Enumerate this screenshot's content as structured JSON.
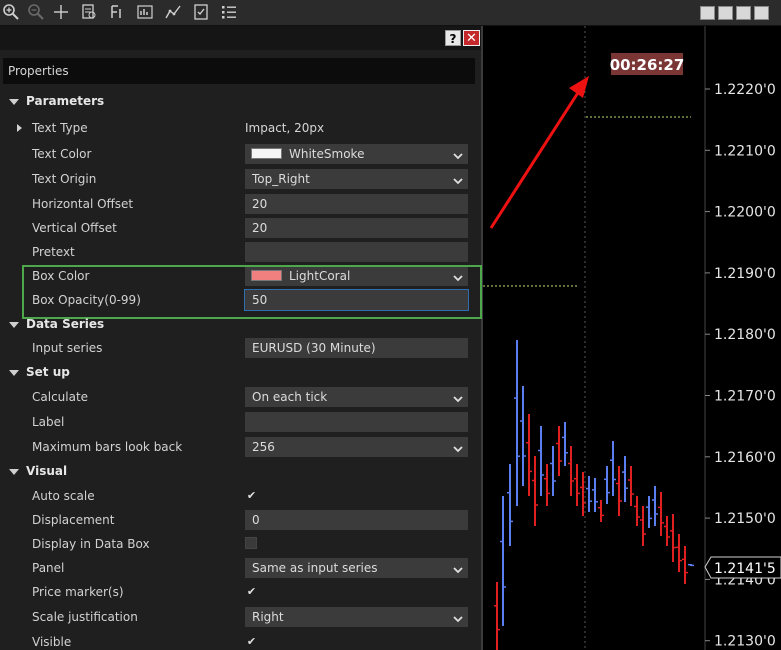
{
  "toolbar": {
    "icons": [
      "zoom-in-icon",
      "zoom-out-icon",
      "crosshair-icon",
      "data-box-icon",
      "bar-style-icon",
      "chart-style-icon",
      "drawing-tools-icon",
      "properties-icon",
      "list-icon"
    ]
  },
  "dialog": {
    "help_label": "?",
    "close_label": "✕",
    "header": "Properties"
  },
  "sections": {
    "parameters": "Parameters",
    "data_series": "Data Series",
    "setup": "Set up",
    "visual": "Visual"
  },
  "props": {
    "text_type": {
      "label": "Text Type",
      "value": "Impact, 20px"
    },
    "text_color": {
      "label": "Text Color",
      "value": "WhiteSmoke",
      "swatch": "#f5f5f5"
    },
    "text_origin": {
      "label": "Text Origin",
      "value": "Top_Right"
    },
    "horizontal_offset": {
      "label": "Horizontal Offset",
      "value": "20"
    },
    "vertical_offset": {
      "label": "Vertical Offset",
      "value": "20"
    },
    "pretext": {
      "label": "Pretext",
      "value": ""
    },
    "box_color": {
      "label": "Box Color",
      "value": "LightCoral",
      "swatch": "#f08080"
    },
    "box_opacity": {
      "label": "Box Opacity(0-99)",
      "value": "50"
    },
    "input_series": {
      "label": "Input series",
      "value": "EURUSD (30 Minute)"
    },
    "calculate": {
      "label": "Calculate",
      "value": "On each tick"
    },
    "label": {
      "label": "Label",
      "value": ""
    },
    "max_bars": {
      "label": "Maximum bars look back",
      "value": "256"
    },
    "auto_scale": {
      "label": "Auto scale",
      "value": "✔"
    },
    "displacement": {
      "label": "Displacement",
      "value": "0"
    },
    "display_data_box": {
      "label": "Display in Data Box"
    },
    "panel": {
      "label": "Panel",
      "value": "Same as input series"
    },
    "price_markers": {
      "label": "Price marker(s)",
      "value": "✔"
    },
    "scale_justification": {
      "label": "Scale justification",
      "value": "Right"
    },
    "visible": {
      "label": "Visible",
      "value": "✔"
    }
  },
  "chart": {
    "timer": "00:26:27",
    "timer_box_color": "#7a3535",
    "price_labels": [
      "1.2220'0",
      "1.2210'0",
      "1.2200'0",
      "1.2190'0",
      "1.2180'0",
      "1.2170'0",
      "1.2160'0",
      "1.2150'0",
      "1.2140'0",
      "1.2130'0"
    ],
    "current_price": "1.2141'5",
    "up_color": "#5b7ff0",
    "down_color": "#e02020",
    "arrow_color": "#ee1111"
  }
}
